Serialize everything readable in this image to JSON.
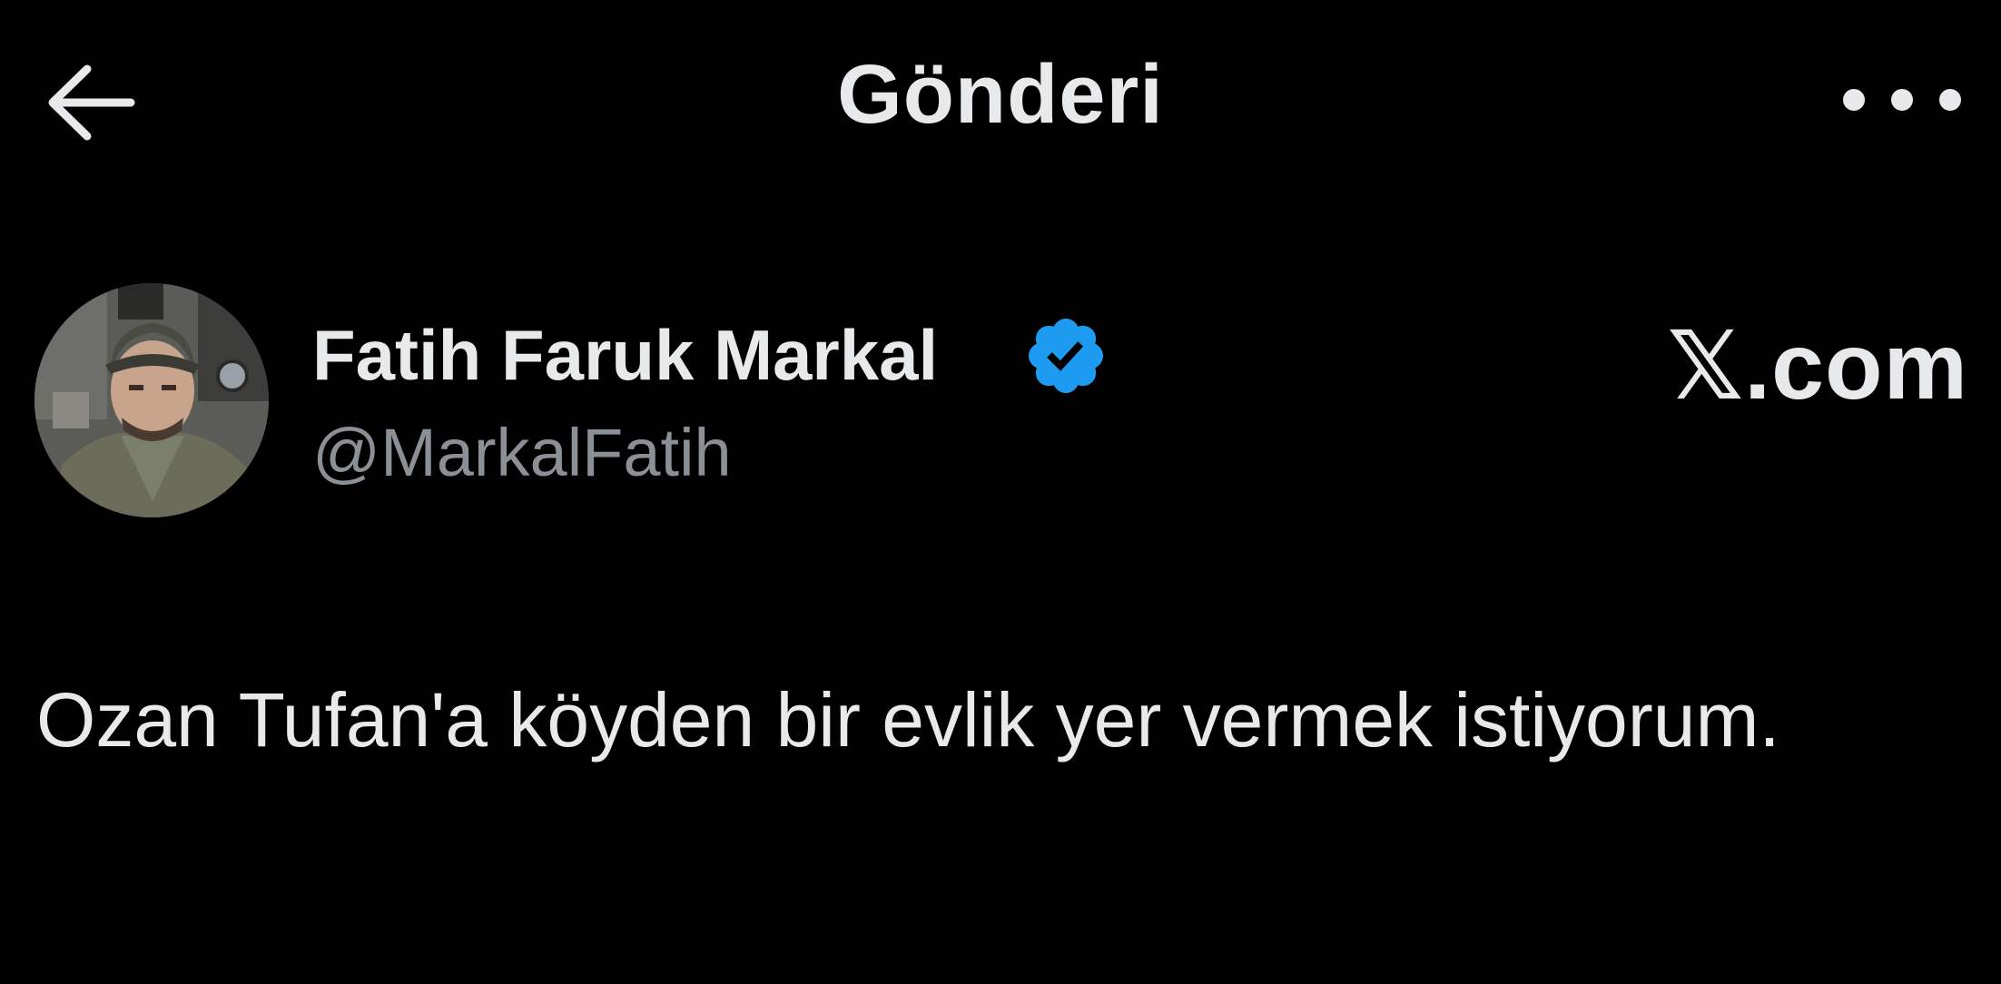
{
  "header": {
    "title": "Gönderi"
  },
  "author": {
    "display_name": "Fatih Faruk Markal",
    "handle": "@MarkalFatih",
    "verified": true
  },
  "source": {
    "label": "𝕏.com"
  },
  "post": {
    "text": "Ozan Tufan'a köyden bir evlik yer vermek istiyorum."
  },
  "colors": {
    "background": "#000000",
    "text": "#e7e9ea",
    "secondary_text": "#8b9096",
    "verified_blue": "#1d9bf0"
  },
  "icons": {
    "back": "arrow-left-icon",
    "more": "more-horizontal-icon",
    "verified": "verified-badge-icon"
  }
}
